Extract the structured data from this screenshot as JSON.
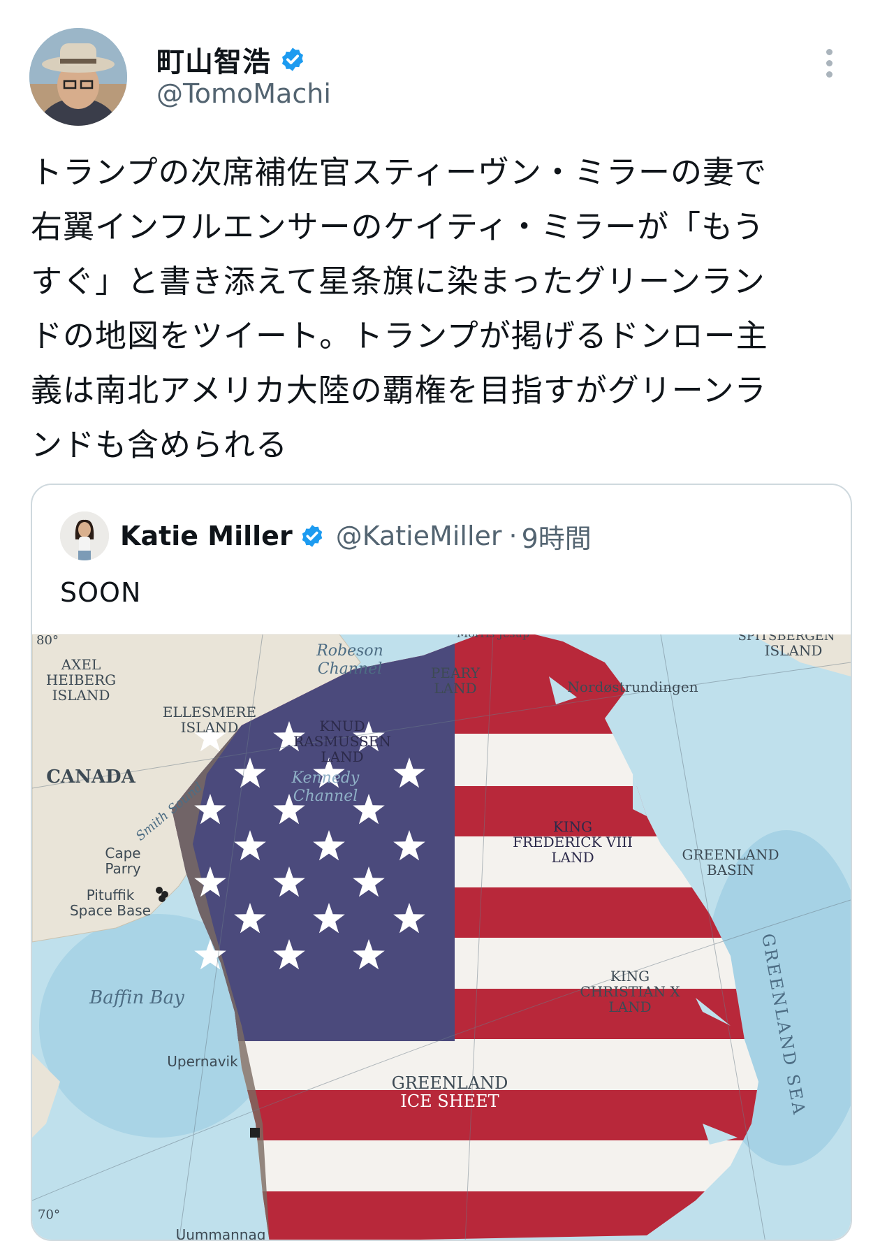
{
  "author": {
    "display_name": "町山智浩",
    "handle": "@TomoMachi",
    "verified": true,
    "avatar_icon": "user-avatar-hat"
  },
  "tweet": {
    "text": "トランプの次席補佐官スティーヴン・ミラーの妻で\n右翼インフルエンサーのケイティ・ミラーが「もう\nすぐ」と書き添えて星条旗に染まったグリーンラン\nドの地図をツイート。トランプが掲げるドンロー主\n義は南北アメリカ大陸の覇権を目指すがグリーンラ\nンドも含められる"
  },
  "quote": {
    "name": "Katie Miller",
    "handle": "@KatieMiller",
    "separator": "·",
    "time": "9時間",
    "text": "SOON"
  },
  "map": {
    "labels": {
      "axel": "AXEL",
      "heiberg": "HEIBERG",
      "island1": "ISLAND",
      "robeson": "Robeson",
      "channel1": "Channel",
      "morris": "Morris Jesup",
      "peary": "PEARY",
      "land1": "LAND",
      "spits": "SPITSBERGEN",
      "island2": "ISLAND",
      "nord": "Nordøstrundingen",
      "ellesmere": "ELLESMERE",
      "island3": "ISLAND",
      "knud": "KNUD",
      "rasmussen": "RASMUSSEN",
      "land2": "LAND",
      "canada": "CANADA",
      "kennedy": "Kennedy",
      "channel2": "Channel",
      "smith": "Smith Sound",
      "king1": "KING",
      "frederick": "FREDERICK VIII",
      "land3": "LAND",
      "cape": "Cape",
      "parry": "Parry",
      "pituffik": "Pituffik",
      "spacebase": "Space Base",
      "basin1": "GREENLAND",
      "basin2": "BASIN",
      "sea": "GREENLAND SEA",
      "baffin": "Baffin Bay",
      "king2": "KING",
      "christian": "CHRISTIAN X",
      "land4": "LAND",
      "upernavik": "Upernavik",
      "ice1": "GREENLAND",
      "ice2": "ICE SHEET",
      "lat80": "80°",
      "lat70": "70°",
      "uummannaq": "Uummannaq"
    },
    "colors": {
      "sea": "#bfe0ec",
      "land": "#e9e4d8",
      "blue_field": "#4b4a7c",
      "red": "#b8283a",
      "white": "#f4f2ee"
    }
  }
}
